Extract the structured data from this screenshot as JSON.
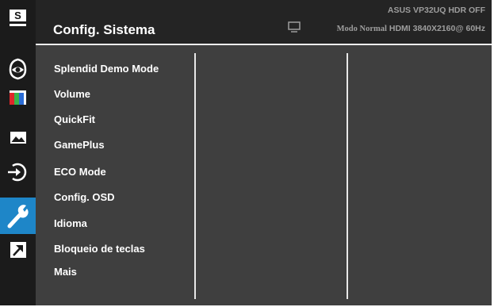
{
  "header": {
    "title": "Config. Sistema",
    "status_line1": "ASUS  VP32UQ  HDR OFF",
    "status_mode": "Modo Normal",
    "status_signal": "HDMI 3840X2160@ 60Hz",
    "input_icon": "monitor-icon"
  },
  "sidebar": {
    "items": [
      {
        "name": "splendid",
        "icon": "s-letter-icon",
        "label": "S",
        "active": false
      },
      {
        "name": "blue-light-filter",
        "icon": "eye-icon",
        "active": false
      },
      {
        "name": "color",
        "icon": "color-bars-icon",
        "active": false
      },
      {
        "name": "image",
        "icon": "landscape-icon",
        "active": false
      },
      {
        "name": "input-select",
        "icon": "input-arrow-icon",
        "active": false
      },
      {
        "name": "system-setup",
        "icon": "wrench-icon",
        "active": true
      },
      {
        "name": "shortcut",
        "icon": "shortcut-arrow-icon",
        "active": false
      }
    ]
  },
  "menu": {
    "items": [
      "Splendid Demo Mode",
      "Volume",
      "QuickFit",
      "GamePlus",
      "ECO Mode",
      "Config. OSD",
      "Idioma",
      "Bloqueio de teclas",
      "Mais"
    ]
  },
  "colors": {
    "panel": "#3f3f3f",
    "sidebar": "#1b1b1b",
    "header": "#242424",
    "accent": "#1e86c8",
    "status_text": "#9d9d9d"
  }
}
